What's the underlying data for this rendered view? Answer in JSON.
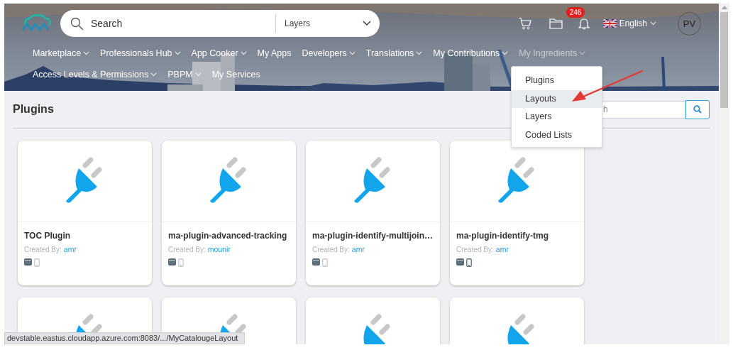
{
  "header": {
    "search": {
      "placeholder": "Search",
      "scope": "Layers"
    },
    "notifications": {
      "count": "246"
    },
    "language": "English",
    "avatar": "PV"
  },
  "nav": {
    "rows": [
      {
        "items": [
          {
            "label": "Marketplace",
            "has_menu": true,
            "open": false
          },
          {
            "label": "Professionals Hub",
            "has_menu": true,
            "open": false
          },
          {
            "label": "App Cooker",
            "has_menu": true,
            "open": false
          },
          {
            "label": "My Apps",
            "has_menu": false,
            "open": false
          },
          {
            "label": "Developers",
            "has_menu": true,
            "open": false
          },
          {
            "label": "Translations",
            "has_menu": true,
            "open": false
          },
          {
            "label": "My Contributions",
            "has_menu": true,
            "open": false
          },
          {
            "label": "My Ingredients",
            "has_menu": true,
            "open": true
          }
        ]
      },
      {
        "items": [
          {
            "label": "Access Levels & Permissions",
            "has_menu": true,
            "open": false
          },
          {
            "label": "PBPM",
            "has_menu": true,
            "open": false
          },
          {
            "label": "My Services",
            "has_menu": false,
            "open": false
          }
        ]
      }
    ]
  },
  "ingredients_menu": {
    "items": [
      {
        "label": "Plugins",
        "selected": false
      },
      {
        "label": "Layouts",
        "selected": true
      },
      {
        "label": "Layers",
        "selected": false
      },
      {
        "label": "Coded Lists",
        "selected": false
      }
    ]
  },
  "page": {
    "title": "Plugins",
    "filter": {
      "placeholder": "h"
    }
  },
  "cards": [
    {
      "kind": "full",
      "title": "TOC Plugin",
      "created_by_label": "Created By:",
      "author": "amr",
      "desktop": true,
      "mobile": false
    },
    {
      "kind": "full",
      "title": "ma-plugin-advanced-tracking",
      "created_by_label": "Created By:",
      "author": "mounir",
      "desktop": true,
      "mobile": false
    },
    {
      "kind": "full",
      "title": "ma-plugin-identify-multijoin…",
      "created_by_label": "Created By:",
      "author": "amr",
      "desktop": true,
      "mobile": false
    },
    {
      "kind": "full",
      "title": "ma-plugin-identify-tmg",
      "created_by_label": "Created By:",
      "author": "amr",
      "desktop": true,
      "mobile": true
    },
    {
      "kind": "partial"
    },
    {
      "kind": "partial"
    },
    {
      "kind": "partial"
    },
    {
      "kind": "partial"
    }
  ],
  "status_bar": "devstable.eastus.cloudapp.azure.com:8083/.../MyCatalougeLayout"
}
